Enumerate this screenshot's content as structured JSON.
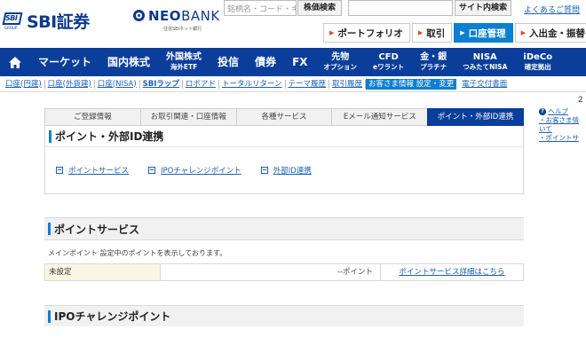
{
  "header": {
    "brand_name": "SBI証券",
    "brand_mark": "SBI",
    "brand_group": "GROUP",
    "neo_bank_bold": "NEO",
    "neo_bank_thin": "BANK",
    "neo_bank_sub": "住信SBIネット銀行",
    "search_placeholder": "銘柄名・コード・キーワ",
    "stock_search_label": "株価検索",
    "site_search_label": "サイト内検索",
    "faq_label": "よくあるご質問",
    "quick_nav": [
      {
        "label": "ポートフォリオ",
        "active": false
      },
      {
        "label": "取引",
        "active": false
      },
      {
        "label": "口座管理",
        "active": true
      },
      {
        "label": "入出金・振替",
        "active": false
      }
    ]
  },
  "main_nav": {
    "items": [
      {
        "label": "マーケット"
      },
      {
        "label": "国内株式"
      },
      {
        "label": "外国株式",
        "sub": "海外ETF"
      },
      {
        "label": "投信"
      },
      {
        "label": "債券"
      },
      {
        "label": "FX"
      },
      {
        "label": "先物",
        "sub": "オプション"
      },
      {
        "label": "CFD",
        "sub": "eワラント"
      },
      {
        "label": "金・銀",
        "sub": "プラチナ"
      },
      {
        "label": "NISA",
        "sub": "つみたてNISA"
      },
      {
        "label": "iDeCo",
        "sub": "確定拠出"
      }
    ]
  },
  "sub_nav": {
    "items": [
      {
        "label": "口座(円建)"
      },
      {
        "label": "口座(外貨建)"
      },
      {
        "label": "口座(NISA)"
      },
      {
        "label": "SBIラップ",
        "bold": true
      },
      {
        "label": "ロボアド"
      },
      {
        "label": "トータルリターン"
      },
      {
        "label": "テーマ履歴"
      },
      {
        "label": "取引履歴"
      },
      {
        "label": "お客さま情報 設定・変更",
        "active": true
      },
      {
        "label": "電子交付書面"
      }
    ],
    "page_marker": "2"
  },
  "tabs": [
    {
      "label": "ご登録情報"
    },
    {
      "label": "お取引関連・口座情報"
    },
    {
      "label": "各種サービス"
    },
    {
      "label": "Eメール通知サービス"
    },
    {
      "label": "ポイント・外部ID連携",
      "active": true
    }
  ],
  "section_main": {
    "title": "ポイント・外部ID連携",
    "links": [
      {
        "label": "ポイントサービス"
      },
      {
        "label": "IPOチャレンジポイント"
      },
      {
        "label": "外部ID連携"
      }
    ]
  },
  "section_points": {
    "title": "ポイントサービス",
    "note": "メインポイント 設定中のポイントを表示しております。",
    "row_label": "未設定",
    "row_value": "--ポイント",
    "row_link": "ポイントサービス詳細はこちら"
  },
  "section_ipo": {
    "title": "IPOチャレンジポイント"
  },
  "help": {
    "help_label": "ヘルプ",
    "items": [
      "・お客さま情",
      "いて",
      "・ポイントサ"
    ]
  },
  "colors": {
    "brand_blue": "#0a3e9a",
    "accent_blue": "#0b7fd1",
    "link_blue": "#1a5fb4",
    "arrow_orange": "#e04a1a"
  }
}
